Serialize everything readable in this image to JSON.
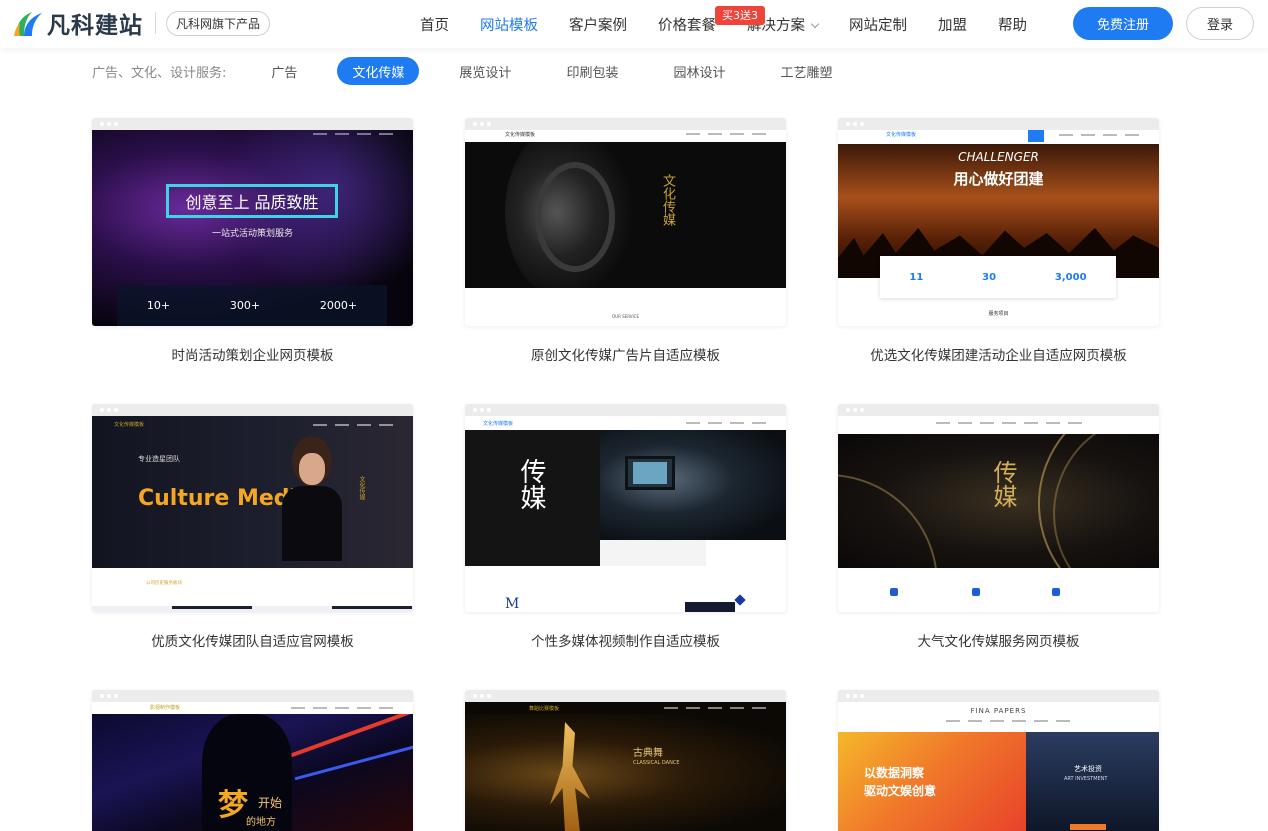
{
  "brand": {
    "logo_text": "凡科建站",
    "badge": "凡科网旗下产品",
    "accent": "#1e7bf2",
    "promo_color": "#f0443a"
  },
  "nav": {
    "items": [
      {
        "label": "首页"
      },
      {
        "label": "网站模板",
        "active": true
      },
      {
        "label": "客户案例"
      },
      {
        "label": "价格套餐"
      },
      {
        "label": "解决方案",
        "promo": "买3送3",
        "dropdown": true
      },
      {
        "label": "网站定制"
      },
      {
        "label": "加盟"
      },
      {
        "label": "帮助"
      }
    ],
    "register": "免费注册",
    "login": "登录"
  },
  "filters": {
    "label": "广告、文化、设计服务:",
    "items": [
      "广告",
      "文化传媒",
      "展览设计",
      "印刷包装",
      "园林设计",
      "工艺雕塑"
    ],
    "active_index": 1
  },
  "cards": [
    {
      "title": "时尚活动策划企业网页模板",
      "preview": {
        "headline": "创意至上 品质致胜",
        "sub": "一站式活动策划服务",
        "stats": [
          "10+",
          "300+",
          "2000+"
        ]
      }
    },
    {
      "title": "原创文化传媒广告片自适应模板",
      "preview": {
        "site": "文化传媒模板",
        "chars": "文化传媒",
        "footer": "OUR SERVICE"
      }
    },
    {
      "title": "优选文化传媒团建活动企业自适应网页模板",
      "preview": {
        "site": "文化传媒模板",
        "script": "CHALLENGER",
        "headline": "用心做好团建",
        "stats": [
          "11",
          "30",
          "3,000"
        ],
        "section": "服务项目"
      }
    },
    {
      "title": "优质文化传媒团队自适应官网模板",
      "preview": {
        "site": "文化传媒模板",
        "team": "专业造星团队",
        "headline": "Culture Media",
        "side": "文化传媒",
        "section": "公司历史服务板块"
      }
    },
    {
      "title": "个性多媒体视频制作自适应模板",
      "preview": {
        "site": "文化传媒模板",
        "chars": "传媒",
        "letter": "M"
      }
    },
    {
      "title": "大气文化传媒服务网页模板",
      "preview": {
        "chars": "传媒"
      }
    },
    {
      "title": "",
      "preview": {
        "site": "影视制作模板",
        "chars": "梦",
        "sub": "开始",
        "sub2": "的地方"
      }
    },
    {
      "title": "",
      "preview": {
        "site": "舞蹈比赛模板",
        "cn": "古典舞",
        "en": "CLASSICAL DANCE"
      }
    },
    {
      "title": "",
      "preview": {
        "site": "FINA PAPERS",
        "left1": "以数据洞察",
        "left2": "驱动文娱创意",
        "right1": "艺术投资",
        "right2": "ART INVESTMENT"
      }
    }
  ]
}
